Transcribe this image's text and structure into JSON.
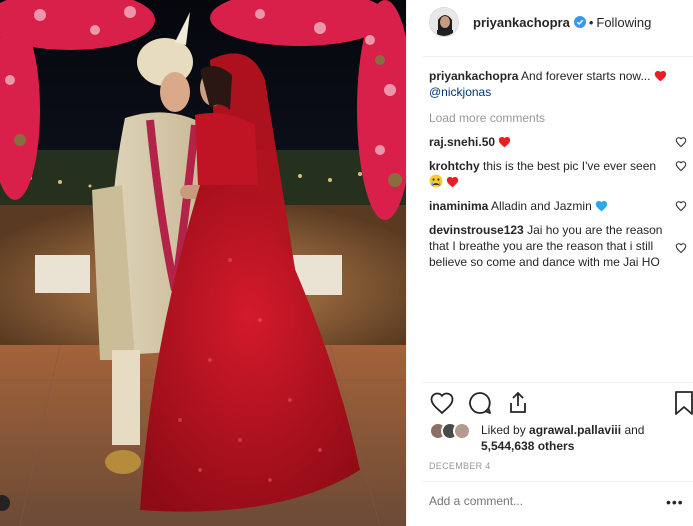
{
  "post": {
    "username": "priyankachopra",
    "dot": "•",
    "follow_label": "Following"
  },
  "caption": {
    "username": "priyankachopra",
    "text": "And forever starts now...",
    "mention": "@nickjonas"
  },
  "load_more_label": "Load more comments",
  "comments": [
    {
      "username": "raj.snehi.50",
      "text": ""
    },
    {
      "username": "krohtchy",
      "text": "this is the best pic I've ever seen"
    },
    {
      "username": "inaminima",
      "text": "Alladin and Jazmin"
    },
    {
      "username": "devinstrouse123",
      "text": "Jai ho you are the reason that I breathe you are the reason that i still believe so come and dance with me Jai HO"
    }
  ],
  "likes": {
    "prefix": "Liked by",
    "liker": "agrawal.pallaviii",
    "and": "and",
    "others": "5,544,638 others"
  },
  "date": "DECEMBER 4",
  "add_comment_placeholder": "Add a comment...",
  "more_label": "•••",
  "colors": {
    "heart_red": "#ed4956",
    "verified_blue": "#3897f0",
    "mention_blue": "#003569",
    "muted_gray": "#999999"
  },
  "icons": [
    "verified-icon",
    "heart-icon",
    "comment-icon",
    "share-icon",
    "bookmark-icon",
    "more-icon"
  ]
}
